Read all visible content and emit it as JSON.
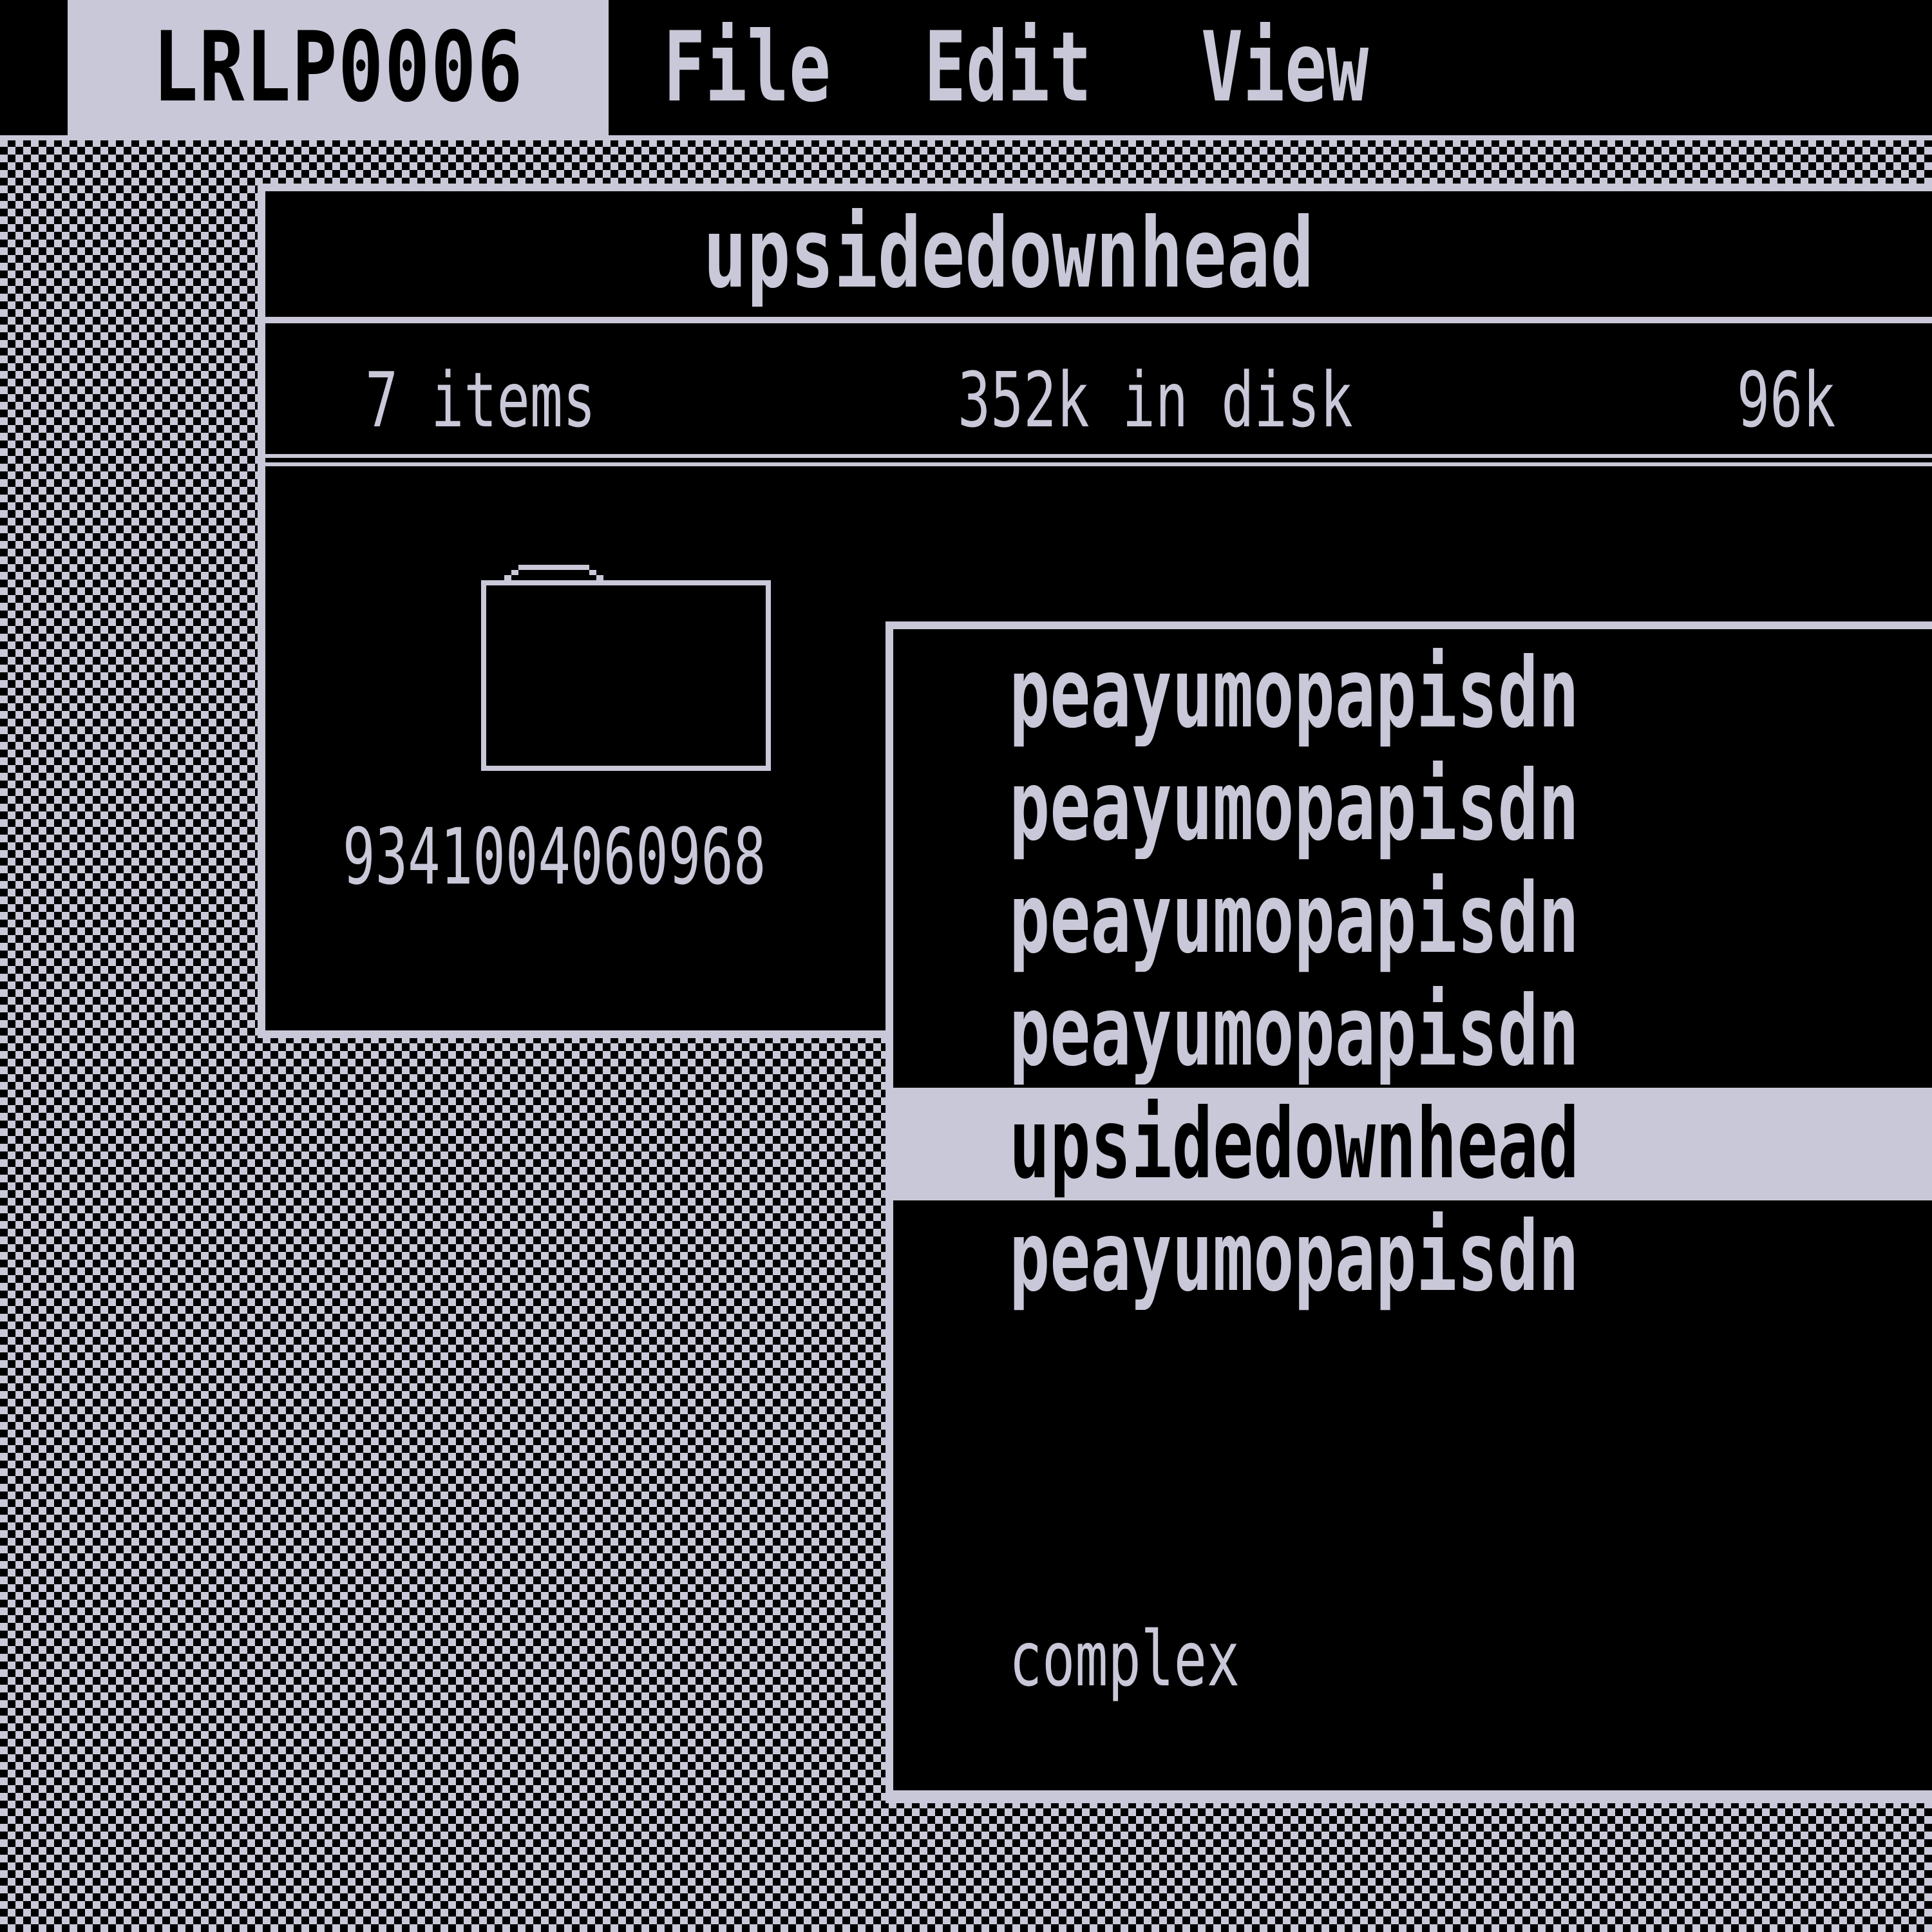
{
  "menubar": {
    "app_name": "LRLP0006",
    "menus": [
      {
        "label": "File"
      },
      {
        "label": "Edit"
      },
      {
        "label": "View"
      }
    ]
  },
  "window": {
    "title": "upsidedownhead",
    "info": {
      "item_count": "7 items",
      "disk_usage": "352k in disk",
      "available": "96k"
    },
    "items": [
      {
        "icon": "folder-icon",
        "label": "9341004060968"
      }
    ]
  },
  "popup_menu": {
    "items": [
      {
        "label": "peayumopapisdn",
        "selected": false
      },
      {
        "label": "peayumopapisdn",
        "selected": false
      },
      {
        "label": "peayumopapisdn",
        "selected": false
      },
      {
        "label": "peayumopapisdn",
        "selected": false
      },
      {
        "label": "upsidedownhead",
        "selected": true
      },
      {
        "label": "peayumopapisdn",
        "selected": false
      }
    ],
    "footer_note": "complex"
  },
  "colors": {
    "foreground": "#c8c8d8",
    "background": "#000000"
  }
}
